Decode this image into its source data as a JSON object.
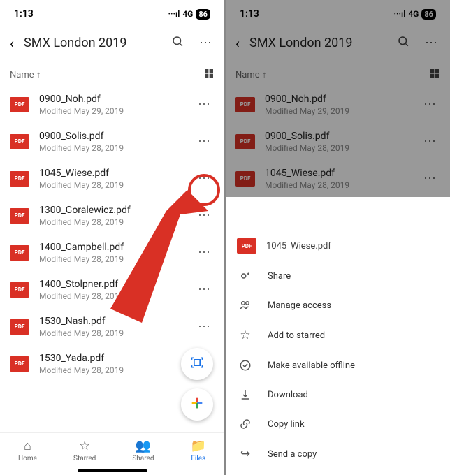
{
  "status": {
    "time": "1:13",
    "signal": "···ıl",
    "network": "4G",
    "battery": "86"
  },
  "header": {
    "title": "SMX London 2019"
  },
  "sort": {
    "label": "Name ↑"
  },
  "pdf_label": "PDF",
  "files": [
    {
      "name": "0900_Noh.pdf",
      "modified": "Modified May 29, 2019"
    },
    {
      "name": "0900_Solis.pdf",
      "modified": "Modified May 28, 2019"
    },
    {
      "name": "1045_Wiese.pdf",
      "modified": "Modified May 28, 2019"
    },
    {
      "name": "1300_Goralewicz.pdf",
      "modified": "Modified May 28, 2019"
    },
    {
      "name": "1400_Campbell.pdf",
      "modified": "Modified May 28, 2019"
    },
    {
      "name": "1400_Stolpner.pdf",
      "modified": "Modified May 28, 2019"
    },
    {
      "name": "1530_Nash.pdf",
      "modified": "Modified May 28, 2019"
    },
    {
      "name": "1530_Yada.pdf",
      "modified": "Modified May 28, 2019"
    }
  ],
  "left_visible_files": 8,
  "right_visible_files": 3,
  "tabs": [
    {
      "label": "Home",
      "icon": "⌂"
    },
    {
      "label": "Starred",
      "icon": "☆"
    },
    {
      "label": "Shared",
      "icon": "👥"
    },
    {
      "label": "Files",
      "icon": "📁"
    }
  ],
  "active_tab": 3,
  "sheet": {
    "file": "1045_Wiese.pdf",
    "items": [
      {
        "label": "Share",
        "icon": "share"
      },
      {
        "label": "Manage access",
        "icon": "manage"
      },
      {
        "label": "Add to starred",
        "icon": "star"
      },
      {
        "label": "Make available offline",
        "icon": "offline"
      },
      {
        "label": "Download",
        "icon": "download"
      },
      {
        "label": "Copy link",
        "icon": "link"
      },
      {
        "label": "Send a copy",
        "icon": "send"
      }
    ]
  },
  "colors": {
    "accent_red": "#d93025",
    "accent_blue": "#1a73e8"
  }
}
